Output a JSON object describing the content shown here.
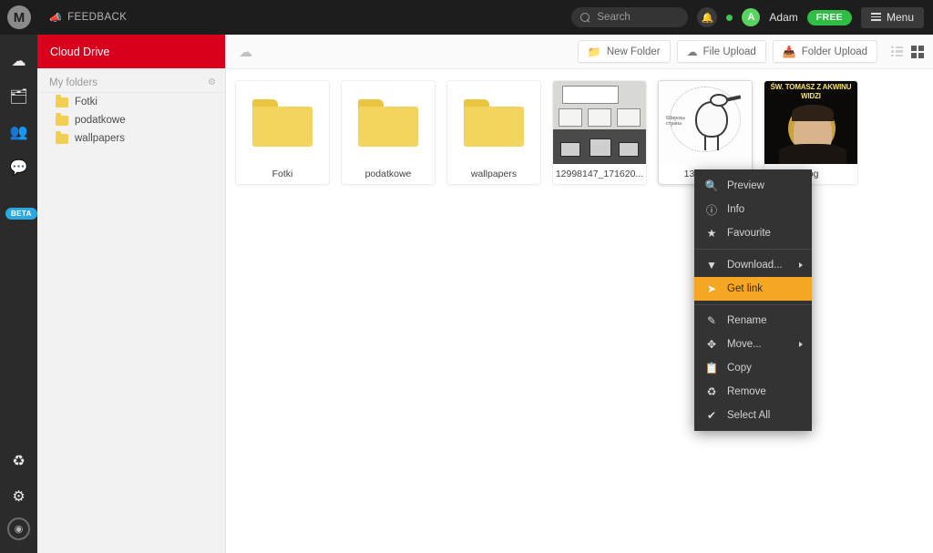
{
  "topbar": {
    "logo_letter": "M",
    "feedback_label": "FEEDBACK",
    "feedback_icon": "megaphone-icon",
    "search": {
      "placeholder": "Search",
      "value": "",
      "icon": "search-icon"
    },
    "bell_icon": "bell-icon",
    "status_dot": "online-dot",
    "avatar_letter": "A",
    "user_name": "Adam",
    "plan_badge": "FREE",
    "menu_label": "Menu",
    "menu_icon": "hamburger-icon",
    "background_color": "#1d1d1d"
  },
  "rail": {
    "items": [
      {
        "name": "cloud-drive",
        "icon": "cloud-icon",
        "glyph": "☁"
      },
      {
        "name": "shared-with-me",
        "icon": "shared-folder-icon",
        "glyph": "▤"
      },
      {
        "name": "contacts",
        "icon": "contacts-icon",
        "glyph": "👥"
      },
      {
        "name": "chat",
        "icon": "chat-bubble-icon",
        "glyph": "💬"
      }
    ],
    "beta_badge": "BETA",
    "bottom_items": [
      {
        "name": "rubbish-bin",
        "icon": "recycle-icon",
        "glyph": "♻"
      },
      {
        "name": "settings",
        "icon": "gear-icon",
        "glyph": "⚙"
      },
      {
        "name": "storage-meter",
        "icon": "storage-gauge-icon",
        "glyph": "◉"
      }
    ],
    "background_color": "#2b2b2b"
  },
  "sidebar": {
    "header_title": "Cloud Drive",
    "header_color": "#d9001b",
    "section_label": "My folders",
    "sort_icon": "sort-updown-icon",
    "folders": [
      {
        "label": "Fotki",
        "icon": "folder-icon"
      },
      {
        "label": "podatkowe",
        "icon": "folder-icon"
      },
      {
        "label": "wallpapers",
        "icon": "folder-icon"
      }
    ]
  },
  "toolbar": {
    "breadcrumb_icon": "cloud-icon",
    "buttons": [
      {
        "label": "New Folder",
        "icon": "new-folder-icon",
        "glyph": "📁"
      },
      {
        "label": "File Upload",
        "icon": "file-upload-icon",
        "glyph": "☁"
      },
      {
        "label": "Folder Upload",
        "icon": "folder-upload-icon",
        "glyph": "📥"
      }
    ],
    "view_list_icon": "list-view-icon",
    "view_grid_icon": "grid-view-icon",
    "active_view": "grid"
  },
  "files": [
    {
      "name": "Fotki",
      "type": "folder",
      "selected": false
    },
    {
      "name": "podatkowe",
      "type": "folder",
      "selected": false
    },
    {
      "name": "wallpapers",
      "type": "folder",
      "selected": false
    },
    {
      "name": "12998147_171620...",
      "type": "image",
      "thumb": "comic-strip",
      "selected": false
    },
    {
      "name": "13043413",
      "type": "image",
      "thumb": "bird-drawing",
      "selected": true
    },
    {
      "name": ".jpg",
      "type": "image",
      "thumb": "saint-meme",
      "selected": false
    }
  ],
  "context_menu": {
    "items": [
      {
        "label": "Preview",
        "icon": "search-icon",
        "glyph": "🔍",
        "submenu": false,
        "highlighted": false
      },
      {
        "label": "Info",
        "icon": "info-icon",
        "glyph": "ℹ",
        "submenu": false,
        "highlighted": false
      },
      {
        "label": "Favourite",
        "icon": "star-icon",
        "glyph": "★",
        "submenu": false,
        "highlighted": false
      },
      {
        "separator": true
      },
      {
        "label": "Download...",
        "icon": "download-icon",
        "glyph": "⬇",
        "submenu": true,
        "highlighted": false
      },
      {
        "label": "Get link",
        "icon": "link-arrow-icon",
        "glyph": "➤",
        "submenu": false,
        "highlighted": true
      },
      {
        "separator": true
      },
      {
        "label": "Rename",
        "icon": "pencil-icon",
        "glyph": "✎",
        "submenu": false,
        "highlighted": false
      },
      {
        "label": "Move...",
        "icon": "move-arrows-icon",
        "glyph": "✥",
        "submenu": true,
        "highlighted": false
      },
      {
        "label": "Copy",
        "icon": "copy-icon",
        "glyph": "❐",
        "submenu": false,
        "highlighted": false
      },
      {
        "label": "Remove",
        "icon": "recycle-icon",
        "glyph": "♻",
        "submenu": false,
        "highlighted": false
      },
      {
        "label": "Select All",
        "icon": "check-icon",
        "glyph": "✔",
        "submenu": false,
        "highlighted": false
      }
    ],
    "highlight_color": "#f5a623",
    "background_color": "#333333"
  },
  "thumbnail_text": {
    "meme_line1": "ŚW. TOMASZ Z AKWINU",
    "meme_line2": "WIDZI",
    "scribble": "Широка страна"
  }
}
